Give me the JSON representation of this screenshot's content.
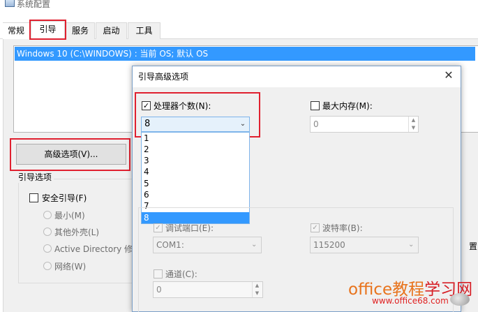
{
  "window": {
    "title": "系统配置"
  },
  "tabs": [
    {
      "label": "常规"
    },
    {
      "label": "引导"
    },
    {
      "label": "服务"
    },
    {
      "label": "启动"
    },
    {
      "label": "工具"
    }
  ],
  "os_list": {
    "selected_entry": "Windows 10 (C:\\WINDOWS) : 当前 OS; 默认 OS"
  },
  "advanced_button_label": "高级选项(V)...",
  "boot_options": {
    "group_label": "引导选项",
    "safe_boot_label": "安全引导(F)",
    "safe_boot_checked": false,
    "radio_options": [
      "最小(M)",
      "其他外壳(L)",
      "Active Directory 修",
      "网络(W)"
    ],
    "right_cut_label": "置(K)"
  },
  "dialog": {
    "title": "引导高级选项",
    "close_icon": "close-icon",
    "processor_count_label": "处理器个数(N):",
    "processor_count_checked": true,
    "processor_count_value": "8",
    "processor_options": [
      "1",
      "2",
      "3",
      "4",
      "5",
      "6",
      "7",
      "8"
    ],
    "processor_selected": "8",
    "max_memory_label": "最大内存(M):",
    "max_memory_checked": false,
    "max_memory_value": "0",
    "debug_port_label": "调试端口(E):",
    "debug_port_checked": true,
    "debug_port_value": "COM1:",
    "baud_rate_label": "波特率(B):",
    "baud_rate_checked": true,
    "baud_rate_value": "115200",
    "channel_label": "通道(C):",
    "channel_checked": false,
    "channel_value": "0"
  },
  "watermark": {
    "brand_a": "office教程",
    "brand_b": "学习网",
    "url": "www.office68.com"
  },
  "colors": {
    "highlight": "#3399ff",
    "annotation_red": "#e0202f",
    "watermark_orange": "#e8731c"
  }
}
